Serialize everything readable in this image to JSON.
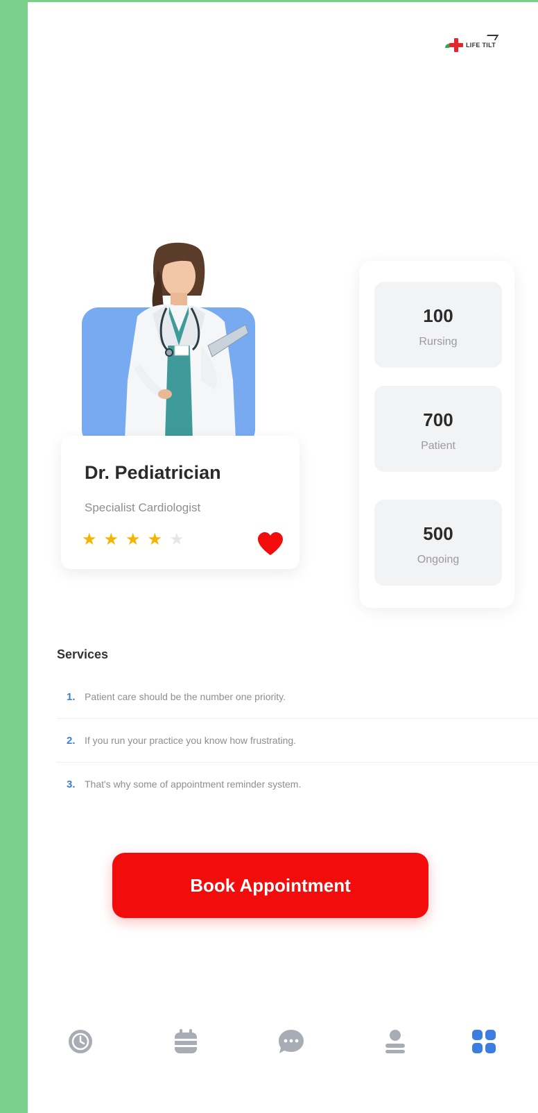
{
  "logo": {
    "text": "LIFE TILT"
  },
  "doctor": {
    "name": "Dr. Pediatrician",
    "specialty": "Specialist Cardiologist",
    "rating": 4,
    "rating_max": 5,
    "favorite": true
  },
  "stats": [
    {
      "value": "100",
      "label": "Rursing"
    },
    {
      "value": "700",
      "label": "Patient"
    },
    {
      "value": "500",
      "label": "Ongoing"
    }
  ],
  "services": {
    "title": "Services",
    "items": [
      {
        "index": "1.",
        "text": "Patient care should be the number one priority."
      },
      {
        "index": "2.",
        "text": "If you run your practice you know how frustrating."
      },
      {
        "index": "3.",
        "text": "That's why some of appointment reminder system."
      }
    ]
  },
  "actions": {
    "book_label": "Book Appointment"
  },
  "nav": {
    "items": [
      {
        "icon": "clock-icon",
        "active": false
      },
      {
        "icon": "calendar-icon",
        "active": false
      },
      {
        "icon": "chat-icon",
        "active": false
      },
      {
        "icon": "user-icon",
        "active": false
      },
      {
        "icon": "grid-icon",
        "active": true
      }
    ]
  },
  "colors": {
    "accent": "#f20c0c",
    "active_nav": "#3b7de0",
    "inactive_nav": "#a8acb4",
    "star": "#f4b400",
    "photo_bg": "#78aaf2",
    "page_bg": "#79d08a"
  }
}
